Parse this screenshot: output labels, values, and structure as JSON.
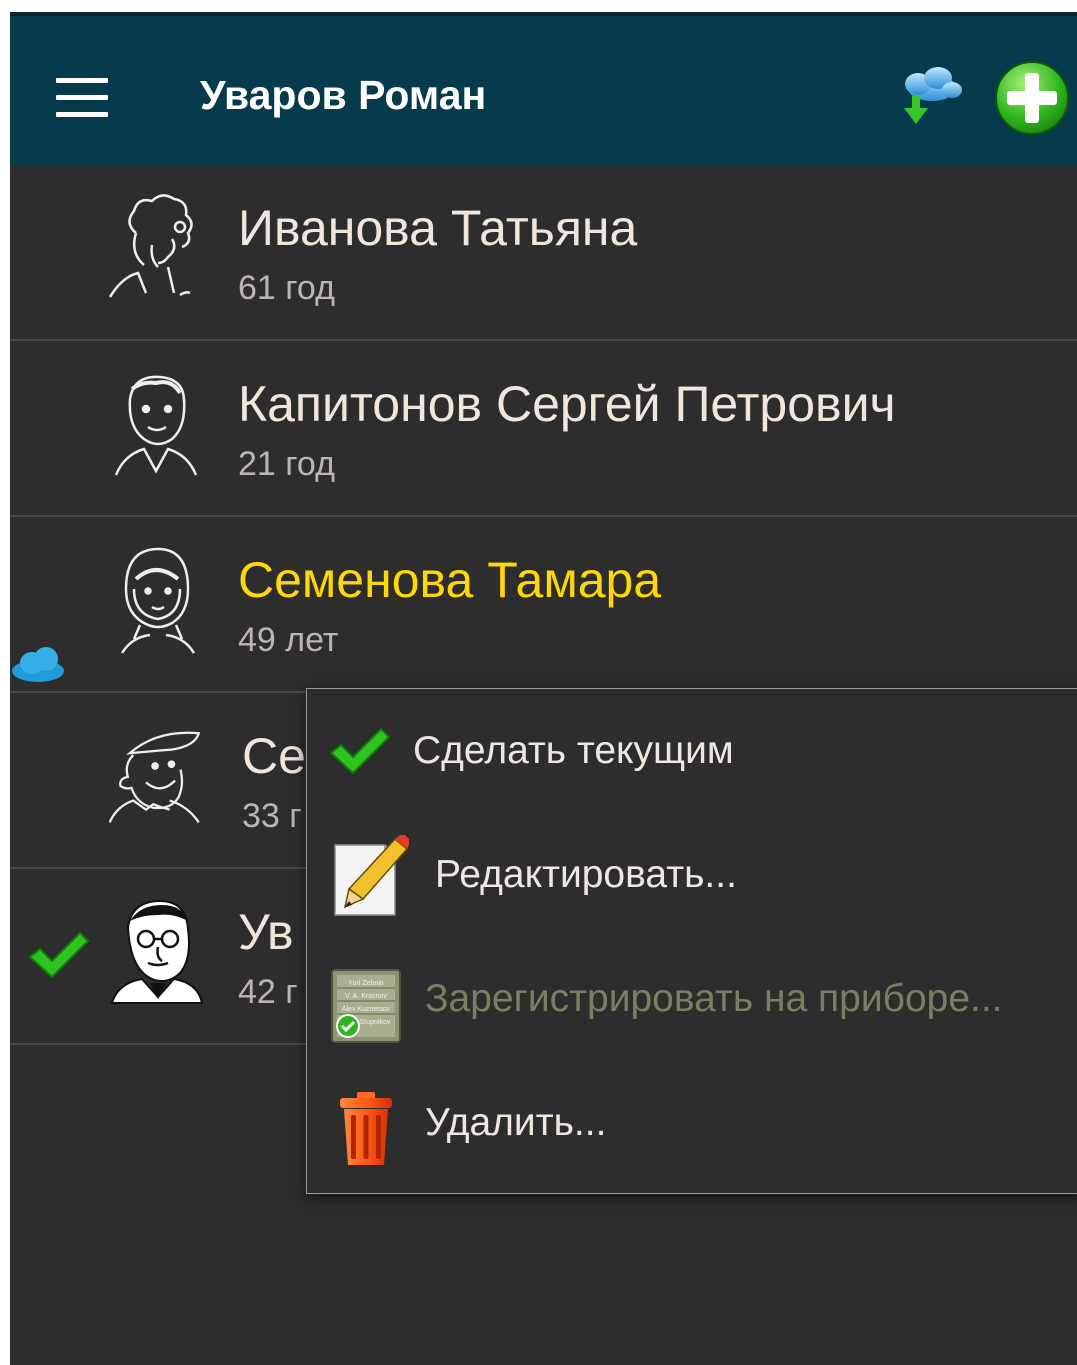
{
  "appbar": {
    "title": "Уваров Роман",
    "menu_icon": "hamburger-menu-icon",
    "sync_icon": "cloud-download-icon",
    "add_icon": "add-plus-icon",
    "color": "#063a4d"
  },
  "patients": [
    {
      "name": "Иванова Татьяна",
      "age": "61 год",
      "avatar": "curly-hair-woman-avatar"
    },
    {
      "name": "Капитонов Сергей Петрович",
      "age": "21 год",
      "avatar": "young-man-avatar"
    },
    {
      "name": "Семенова Тамара",
      "age": "49 лет",
      "avatar": "woman-headscarf-avatar",
      "highlight_color": "#ffd60a",
      "synced": true
    },
    {
      "name": "Се",
      "age": "33 г",
      "avatar": "man-cap-smiling-avatar"
    },
    {
      "name": "Ув",
      "age": "42 г",
      "avatar": "old-man-glasses-avatar",
      "current": true
    }
  ],
  "context_menu": {
    "items": [
      {
        "label": "Сделать текущим",
        "icon": "green-check-icon",
        "enabled": true
      },
      {
        "label": "Редактировать...",
        "icon": "pencil-edit-icon",
        "enabled": true
      },
      {
        "label": "Зарегистрировать на приборе...",
        "icon": "device-list-icon",
        "enabled": false
      },
      {
        "label": "Удалить...",
        "icon": "trash-icon",
        "enabled": true
      }
    ],
    "device_icon_lines": [
      "Yuri Zebnin",
      "V. A. Krasnov",
      "Alex Kuznetsov",
      "Stupnikov"
    ]
  }
}
